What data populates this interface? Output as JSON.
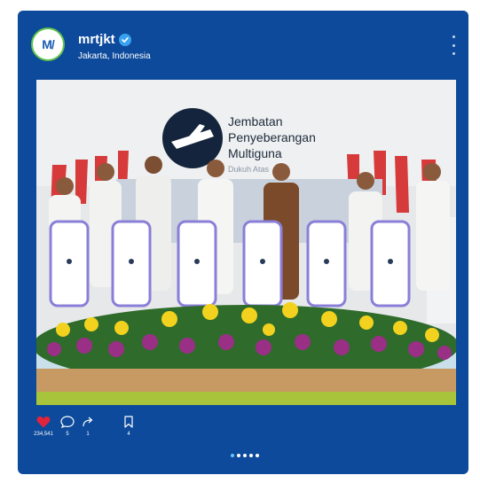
{
  "post": {
    "username": "mrtjkt",
    "location": "Jakarta, Indonesia",
    "avatar_logo_text": "MRT"
  },
  "photo": {
    "signage_lines": [
      "Jembatan",
      "Penyeberangan",
      "Multiguna",
      "Dukuh Atas"
    ]
  },
  "actions": {
    "likes": "234,541",
    "comments": "5",
    "shares": "1",
    "saves": "4"
  },
  "carousel": {
    "total": 5,
    "active_index": 0
  },
  "colors": {
    "card_bg": "#0d4a9b",
    "like_red": "#e0243c",
    "verified_blue": "#3aa3f0",
    "dot_active": "#6fc3ff"
  }
}
